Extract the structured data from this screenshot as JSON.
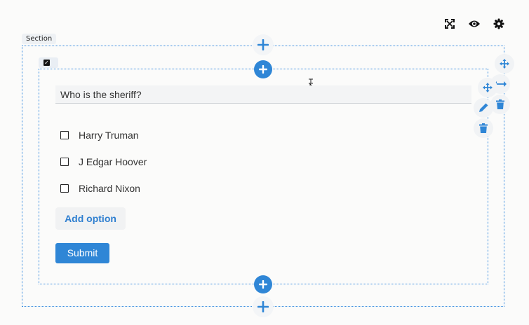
{
  "toolbar": {
    "icons": [
      "expand-icon",
      "eye-icon",
      "gear-icon"
    ]
  },
  "section": {
    "tag_label": "Section"
  },
  "question": {
    "text": "Who is the sheriff?"
  },
  "options": [
    {
      "label": "Harry Truman",
      "checked": false
    },
    {
      "label": "J Edgar Hoover",
      "checked": false
    },
    {
      "label": "Richard Nixon",
      "checked": false
    }
  ],
  "actions": {
    "add_option_label": "Add option",
    "submit_label": "Submit"
  },
  "colors": {
    "accent": "#2f86d6",
    "border": "#3d8fe0"
  }
}
